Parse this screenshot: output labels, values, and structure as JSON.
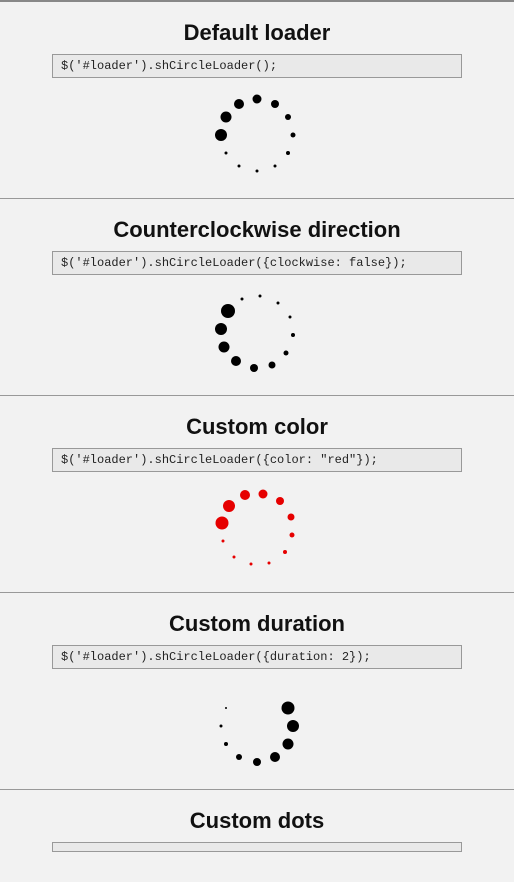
{
  "sections": [
    {
      "id": "default",
      "title": "Default loader",
      "code": "$('#loader').shCircleLoader();",
      "color": "black",
      "dots": 12,
      "radius": 36,
      "startAngle": 180,
      "direction": 1,
      "sizes": [
        12,
        11,
        10,
        9,
        8,
        6,
        5,
        4,
        3,
        3,
        3,
        3
      ]
    },
    {
      "id": "ccw",
      "title": "Counterclockwise direction",
      "code": "$('#loader').shCircleLoader({clockwise: false});",
      "color": "black",
      "dots": 12,
      "radius": 36,
      "startAngle": 215,
      "direction": -1,
      "sizes": [
        14,
        12,
        11,
        10,
        8,
        7,
        5,
        4,
        3,
        3,
        3,
        3
      ]
    },
    {
      "id": "color",
      "title": "Custom color",
      "code": "$('#loader').shCircleLoader({color: \"red\"});",
      "color": "red",
      "dots": 12,
      "radius": 36,
      "startAngle": 190,
      "direction": 1,
      "sizes": [
        13,
        12,
        10,
        9,
        8,
        7,
        5,
        4,
        3,
        3,
        3,
        3
      ]
    },
    {
      "id": "duration",
      "title": "Custom duration",
      "code": "$('#loader').shCircleLoader({duration: 2});",
      "color": "black",
      "dots": 12,
      "radius": 36,
      "startAngle": 330,
      "direction": 1,
      "sizes": [
        13,
        12,
        11,
        10,
        8,
        6,
        4,
        3,
        2,
        0,
        0,
        0
      ]
    },
    {
      "id": "dots",
      "title": "Custom dots",
      "code": "",
      "color": "black",
      "dots": 0,
      "radius": 36,
      "startAngle": 0,
      "direction": 1,
      "sizes": []
    }
  ]
}
